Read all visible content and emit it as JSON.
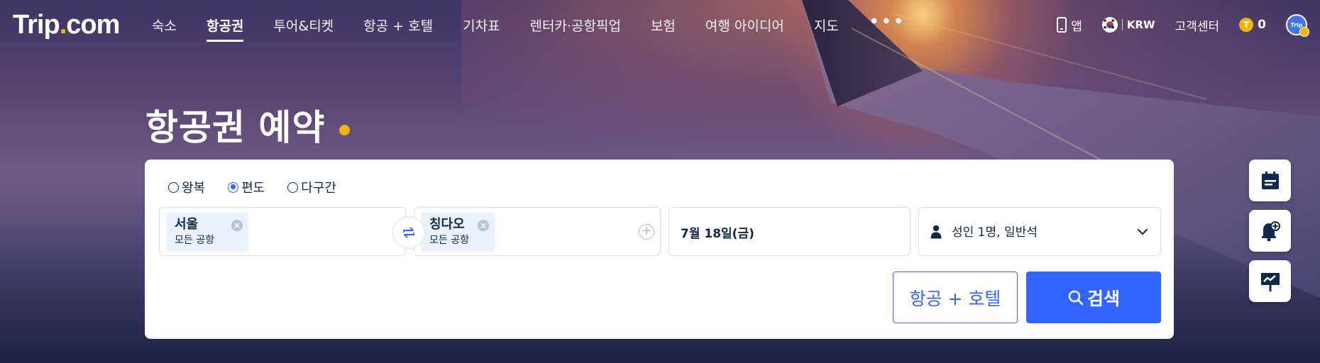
{
  "brand": {
    "logo_left": "Trip",
    "logo_dot": ".",
    "logo_right": "com"
  },
  "nav": {
    "items": [
      {
        "label": "숙소",
        "active": false
      },
      {
        "label": "항공권",
        "active": true
      },
      {
        "label": "투어&티켓",
        "active": false
      },
      {
        "label": "항공 + 호텔",
        "active": false
      },
      {
        "label": "기차표",
        "active": false
      },
      {
        "label": "렌터카·공항픽업",
        "active": false
      },
      {
        "label": "보험",
        "active": false
      },
      {
        "label": "여행 아이디어",
        "active": false
      },
      {
        "label": "지도",
        "active": false
      }
    ],
    "more_label": "•••",
    "right": {
      "app_label": "앱",
      "currency_label": "KRW",
      "support_label": "고객센터",
      "points_label": "0",
      "coin_glyph": "T",
      "avatar_label": "Trip"
    }
  },
  "hero": {
    "title": "항공권 예약"
  },
  "search": {
    "trip_types": [
      {
        "label": "왕복",
        "checked": false
      },
      {
        "label": "편도",
        "checked": true
      },
      {
        "label": "다구간",
        "checked": false
      }
    ],
    "origin": {
      "city": "서울",
      "sub": "모든 공항"
    },
    "destination": {
      "city": "칭다오",
      "sub": "모든 공항"
    },
    "date": "7월 18일(금)",
    "passengers": "성인 1명, 일반석",
    "bundle_button": "항공 + 호텔",
    "search_button": "검색"
  },
  "colors": {
    "primary": "#3264ff",
    "accent": "#f5b400",
    "text": "#0f294d"
  },
  "side_buttons": [
    "calendar-icon",
    "price-alert-bell-icon",
    "price-trend-icon"
  ]
}
